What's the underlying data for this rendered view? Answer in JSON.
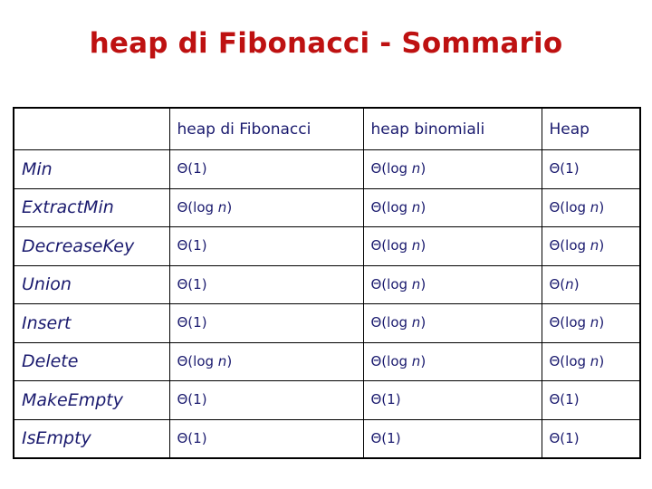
{
  "slide": {
    "title": "heap di Fibonacci - Sommario",
    "title_color": "#BE1111",
    "text_color": "#1A1A6E",
    "background_color": "#FFFFFF",
    "border_color": "#000000"
  },
  "table": {
    "headers": [
      "",
      "heap di Fibonacci",
      "heap binomiali",
      "Heap"
    ],
    "rows": [
      {
        "operation": "Min",
        "fibonacci": "Θ(1)",
        "binomial": "Θ(log n)",
        "heap": "Θ(1)"
      },
      {
        "operation": "ExtractMin",
        "fibonacci": "Θ(log n)",
        "binomial": "Θ(log n)",
        "heap": "Θ(log n)"
      },
      {
        "operation": "DecreaseKey",
        "fibonacci": "Θ(1)",
        "binomial": "Θ(log n)",
        "heap": "Θ(log n)"
      },
      {
        "operation": "Union",
        "fibonacci": "Θ(1)",
        "binomial": "Θ(log n)",
        "heap": "Θ(n)"
      },
      {
        "operation": "Insert",
        "fibonacci": "Θ(1)",
        "binomial": "Θ(log n)",
        "heap": "Θ(log n)"
      },
      {
        "operation": "Delete",
        "fibonacci": "Θ(log n)",
        "binomial": "Θ(log n)",
        "heap": "Θ(log n)"
      },
      {
        "operation": "MakeEmpty",
        "fibonacci": "Θ(1)",
        "binomial": "Θ(1)",
        "heap": "Θ(1)"
      },
      {
        "operation": "IsEmpty",
        "fibonacci": "Θ(1)",
        "binomial": "Θ(1)",
        "heap": "Θ(1)"
      }
    ]
  }
}
